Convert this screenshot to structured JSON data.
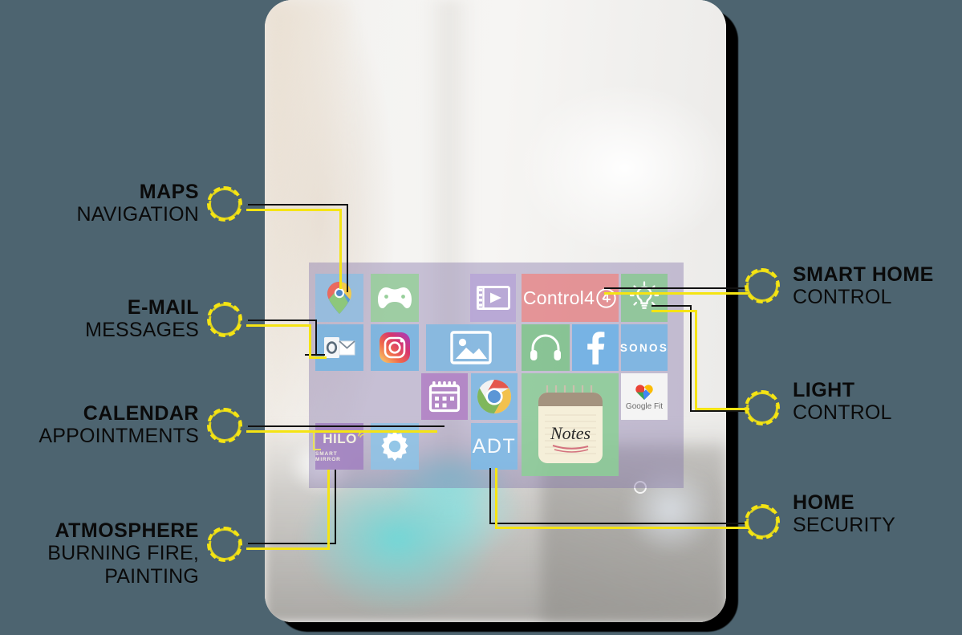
{
  "page": {
    "background_color": "#4d6470",
    "accent_color": "#f5e413",
    "text_color": "#0a0a0a"
  },
  "device": {
    "name": "smart-mirror-tablet",
    "frame_color": "#f2f1ef"
  },
  "callouts_left": [
    {
      "title": "MAPS",
      "subtitle": "NAVIGATION",
      "target": "google-maps-tile"
    },
    {
      "title": "E-MAIL",
      "subtitle": "MESSAGES",
      "target": "outlook-tile"
    },
    {
      "title": "CALENDAR",
      "subtitle": "APPOINTMENTS",
      "target": "calendar-tile"
    },
    {
      "title": "ATMOSPHERE",
      "subtitle": "BURNING FIRE,\nPAINTING",
      "subtitle_line1": "BURNING FIRE,",
      "subtitle_line2": "PAINTING",
      "target": "hilo-tile"
    }
  ],
  "callouts_right": [
    {
      "title": "SMART HOME",
      "subtitle": "CONTROL",
      "target": "control4-tile"
    },
    {
      "title": "LIGHT",
      "subtitle": "CONTROL",
      "target": "light-tile"
    },
    {
      "title": "HOME",
      "subtitle": "SECURITY",
      "target": "adt-tile"
    }
  ],
  "app_grid": {
    "panel_color": "rgba(128,112,168,0.40)",
    "tiles": [
      {
        "id": "google-maps-tile",
        "label": "",
        "icon": "google-maps-pin-icon",
        "color": "#8fbde0"
      },
      {
        "id": "xbox-tile",
        "label": "",
        "icon": "xbox-controller-icon",
        "color": "#97cf9a"
      },
      {
        "id": "movies-tile",
        "label": "",
        "icon": "film-play-icon",
        "color": "#b6a4d6"
      },
      {
        "id": "control4-tile",
        "label": "Control4",
        "icon": "control4-logo",
        "color": "#e98c8c"
      },
      {
        "id": "light-tile",
        "label": "",
        "icon": "lightbulb-icon",
        "color": "#89c893"
      },
      {
        "id": "outlook-tile",
        "label": "",
        "icon": "outlook-icon",
        "color": "#74b4e0"
      },
      {
        "id": "instagram-tile",
        "label": "",
        "icon": "instagram-icon",
        "color": "#74b4e0"
      },
      {
        "id": "photos-tile",
        "label": "",
        "icon": "photo-image-icon",
        "color": "#7fb9e2"
      },
      {
        "id": "headphones-tile",
        "label": "",
        "icon": "headphones-icon",
        "color": "#7ec489"
      },
      {
        "id": "facebook-tile",
        "label": "",
        "icon": "facebook-icon",
        "color": "#6ab2e8"
      },
      {
        "id": "sonos-tile",
        "label": "SONOS",
        "icon": "sonos-logo",
        "color": "#76b5e4"
      },
      {
        "id": "calendar-tile",
        "label": "",
        "icon": "calendar-icon",
        "color": "#b07fc4"
      },
      {
        "id": "chrome-tile",
        "label": "",
        "icon": "chrome-icon",
        "color": "#7bb8e4"
      },
      {
        "id": "notes-tile",
        "label": "Notes",
        "icon": "notes-notepad-icon",
        "color": "#8ccf96"
      },
      {
        "id": "googlefit-tile",
        "label": "Google Fit",
        "icon": "google-fit-heart-icon",
        "color": "#f4f4f4"
      },
      {
        "id": "hilo-tile",
        "label": "HILO",
        "sublabel": "SMART MIRROR",
        "icon": "hilo-logo",
        "color": "#a07ec0"
      },
      {
        "id": "settings-tile",
        "label": "",
        "icon": "gear-icon",
        "color": "#8dc3e6"
      },
      {
        "id": "adt-tile",
        "label": "ADT",
        "icon": "adt-logo",
        "color": "#7cbbe8"
      }
    ]
  }
}
